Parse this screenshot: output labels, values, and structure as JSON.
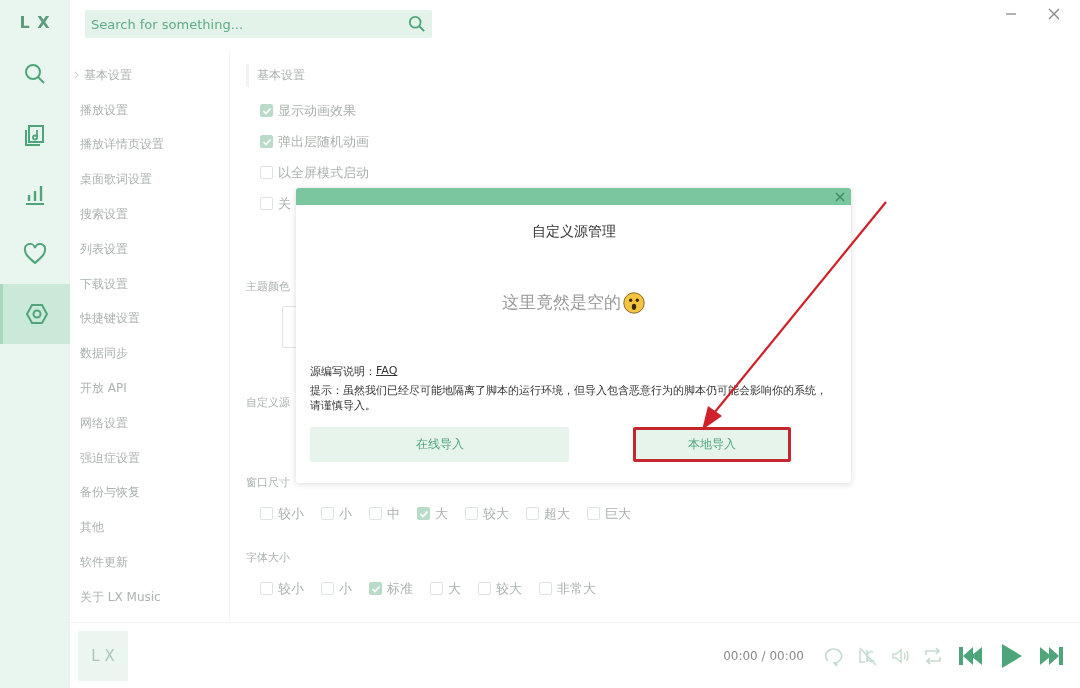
{
  "rail": {
    "logo": "L X",
    "items": [
      {
        "kind": "search",
        "selected": false
      },
      {
        "kind": "songlist",
        "selected": false
      },
      {
        "kind": "chart",
        "selected": false
      },
      {
        "kind": "heart",
        "selected": false
      },
      {
        "kind": "settings",
        "selected": true
      }
    ]
  },
  "search": {
    "placeholder": "Search for something..."
  },
  "settings_nav": [
    {
      "label": "基本设置",
      "selected": true
    },
    {
      "label": "播放设置",
      "selected": false
    },
    {
      "label": "播放详情页设置",
      "selected": false
    },
    {
      "label": "桌面歌词设置",
      "selected": false
    },
    {
      "label": "搜索设置",
      "selected": false
    },
    {
      "label": "列表设置",
      "selected": false
    },
    {
      "label": "下载设置",
      "selected": false
    },
    {
      "label": "快捷键设置",
      "selected": false
    },
    {
      "label": "数据同步",
      "selected": false
    },
    {
      "label": "开放 API",
      "selected": false
    },
    {
      "label": "网络设置",
      "selected": false
    },
    {
      "label": "强迫症设置",
      "selected": false
    },
    {
      "label": "备份与恢复",
      "selected": false
    },
    {
      "label": "其他",
      "selected": false
    },
    {
      "label": "软件更新",
      "selected": false
    },
    {
      "label": "关于 LX Music",
      "selected": false
    }
  ],
  "settings": {
    "heading": "基本设置",
    "options": [
      {
        "label": "显示动画效果",
        "checked": true
      },
      {
        "label": "弹出层随机动画",
        "checked": true
      },
      {
        "label": "以全屏模式启动",
        "checked": false
      },
      {
        "label": "关",
        "checked": false
      }
    ],
    "theme_label": "主题颜色",
    "custom_source_label": "自定义源",
    "window_size": {
      "label": "窗口尺寸",
      "options": [
        {
          "label": "较小",
          "checked": false
        },
        {
          "label": "小",
          "checked": false
        },
        {
          "label": "中",
          "checked": false
        },
        {
          "label": "大",
          "checked": true
        },
        {
          "label": "较大",
          "checked": false
        },
        {
          "label": "超大",
          "checked": false
        },
        {
          "label": "巨大",
          "checked": false
        }
      ]
    },
    "font_size": {
      "label": "字体大小",
      "options": [
        {
          "label": "较小",
          "checked": false
        },
        {
          "label": "小",
          "checked": false
        },
        {
          "label": "标准",
          "checked": true
        },
        {
          "label": "大",
          "checked": false
        },
        {
          "label": "较大",
          "checked": false
        },
        {
          "label": "非常大",
          "checked": false
        }
      ]
    }
  },
  "player": {
    "cover": "L X",
    "time": "00:00 / 00:00"
  },
  "dialog": {
    "title": "自定义源管理",
    "empty_message": "这里竟然是空的",
    "help_label": "源编写说明：",
    "help_link": "FAQ",
    "tip": "提示：虽然我们已经尽可能地隔离了脚本的运行环境，但导入包含恶意行为的脚本仍可能会影响你的系统，请谨慎导入。",
    "buttons": [
      {
        "label": "在线导入",
        "highlighted": false
      },
      {
        "label": "本地导入",
        "highlighted": true
      }
    ]
  }
}
